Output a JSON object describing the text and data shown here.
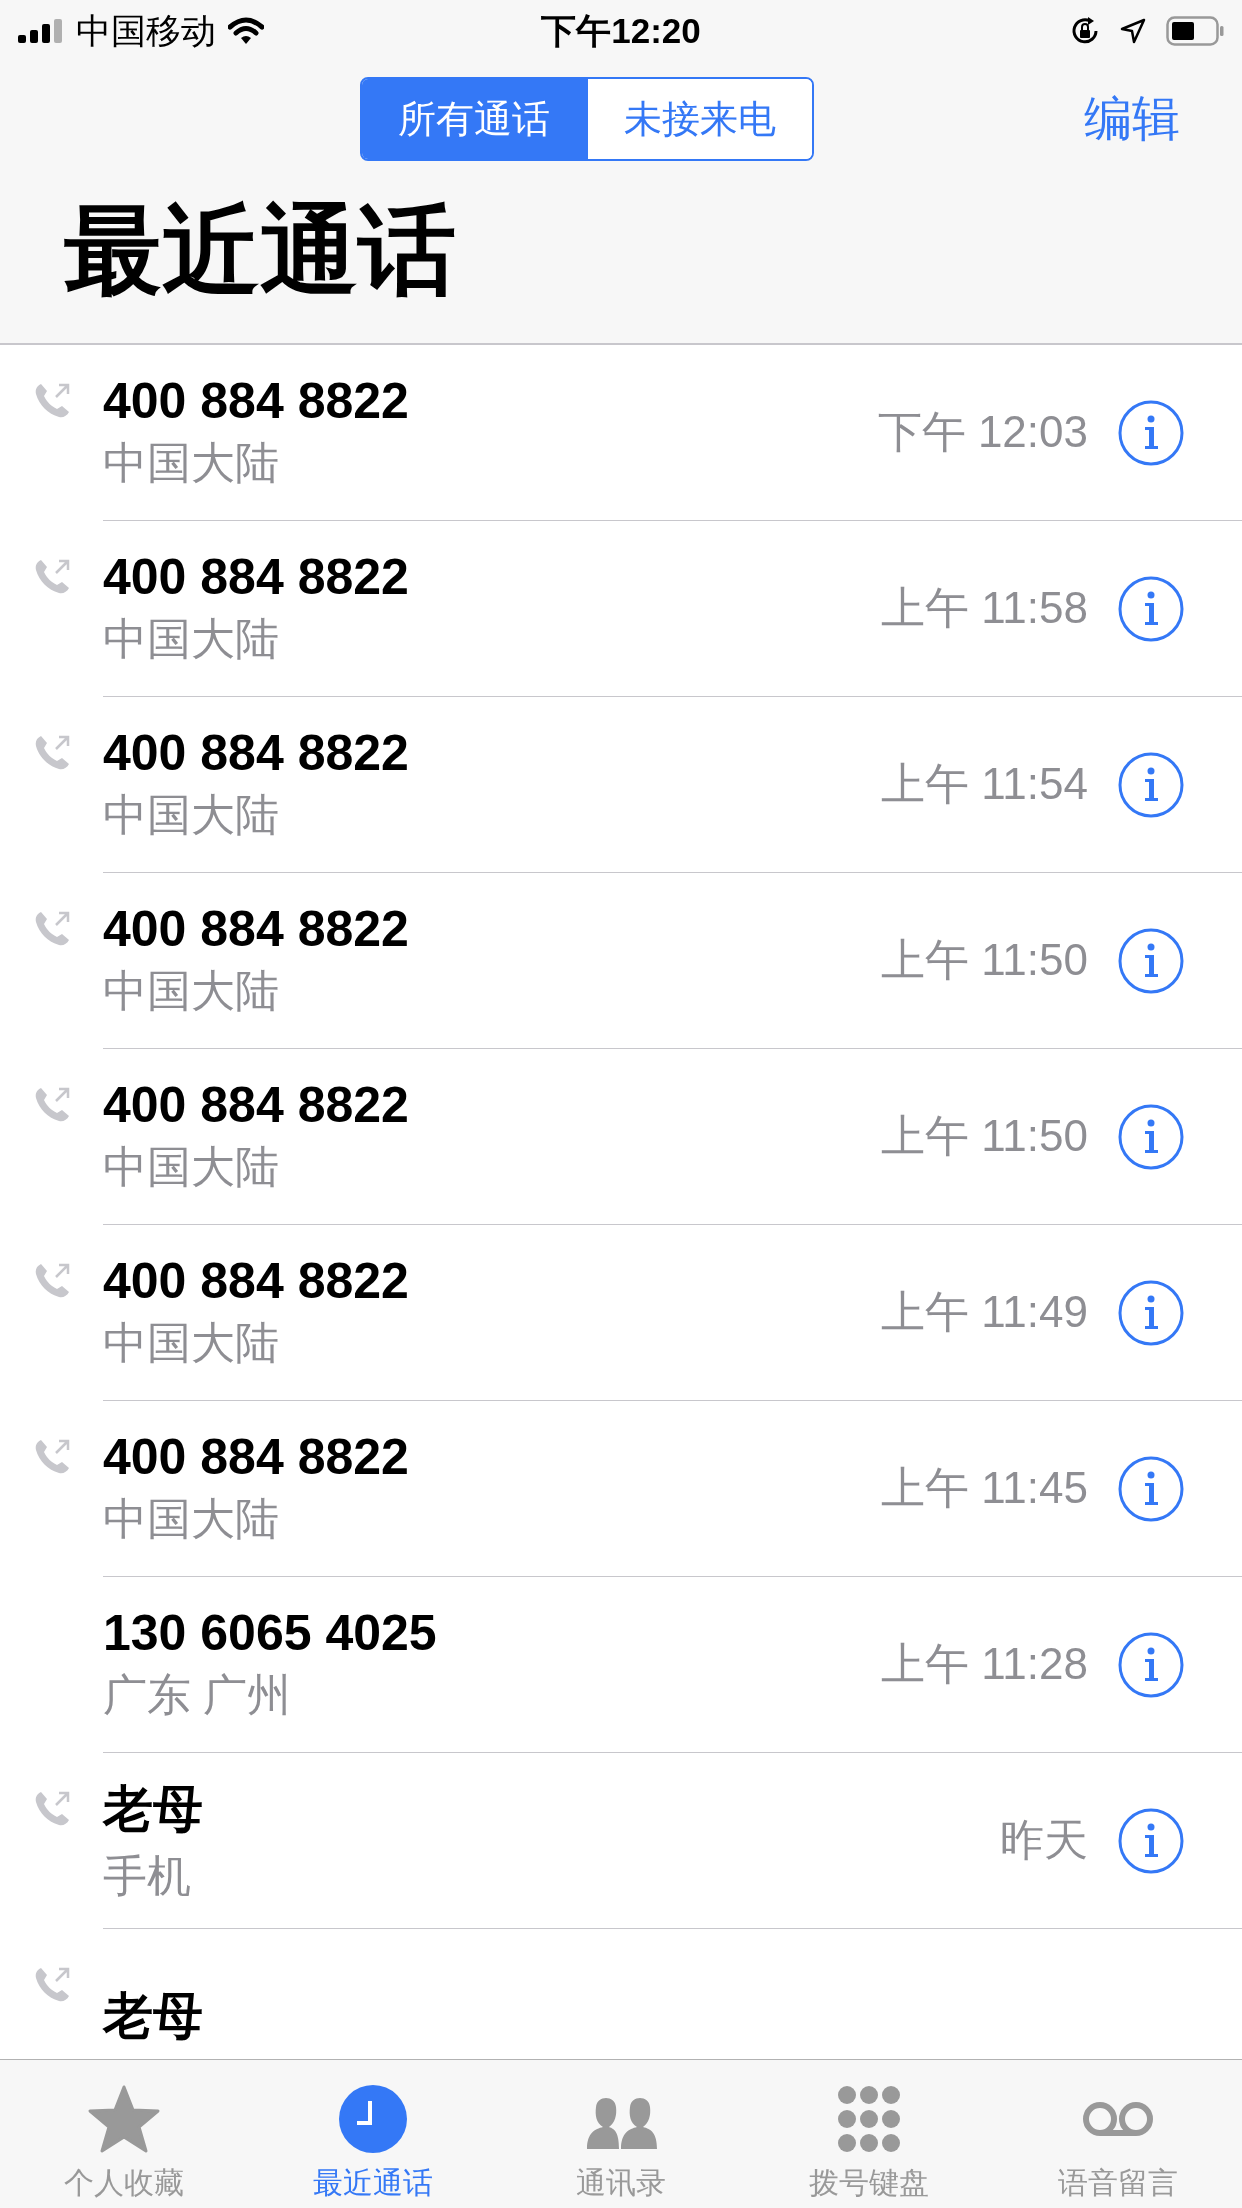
{
  "status_bar": {
    "carrier": "中国移动",
    "time": "下午12:20"
  },
  "nav": {
    "segments": [
      {
        "label": "所有通话",
        "selected": true
      },
      {
        "label": "未接来电",
        "selected": false
      }
    ],
    "edit": "编辑"
  },
  "title": "最近通话",
  "calls": [
    {
      "name": "400 884 8822",
      "subtitle": "中国大陆",
      "time": "下午 12:03",
      "outgoing": true
    },
    {
      "name": "400 884 8822",
      "subtitle": "中国大陆",
      "time": "上午 11:58",
      "outgoing": true
    },
    {
      "name": "400 884 8822",
      "subtitle": "中国大陆",
      "time": "上午 11:54",
      "outgoing": true
    },
    {
      "name": "400 884 8822",
      "subtitle": "中国大陆",
      "time": "上午 11:50",
      "outgoing": true
    },
    {
      "name": "400 884 8822",
      "subtitle": "中国大陆",
      "time": "上午 11:50",
      "outgoing": true
    },
    {
      "name": "400 884 8822",
      "subtitle": "中国大陆",
      "time": "上午 11:49",
      "outgoing": true
    },
    {
      "name": "400 884 8822",
      "subtitle": "中国大陆",
      "time": "上午 11:45",
      "outgoing": true
    },
    {
      "name": "130 6065 4025",
      "subtitle": "广东 广州",
      "time": "上午 11:28",
      "outgoing": false
    },
    {
      "name": "老母",
      "subtitle": "手机",
      "time": "昨天",
      "outgoing": true
    },
    {
      "name": "老母",
      "outgoing": true
    }
  ],
  "tab_bar": [
    {
      "label": "个人收藏",
      "kind": "favorites",
      "selected": false
    },
    {
      "label": "最近通话",
      "kind": "recents",
      "selected": true
    },
    {
      "label": "通讯录",
      "kind": "contacts",
      "selected": false
    },
    {
      "label": "拨号键盘",
      "kind": "keypad",
      "selected": false
    },
    {
      "label": "语音留言",
      "kind": "voicemail",
      "selected": false
    }
  ]
}
